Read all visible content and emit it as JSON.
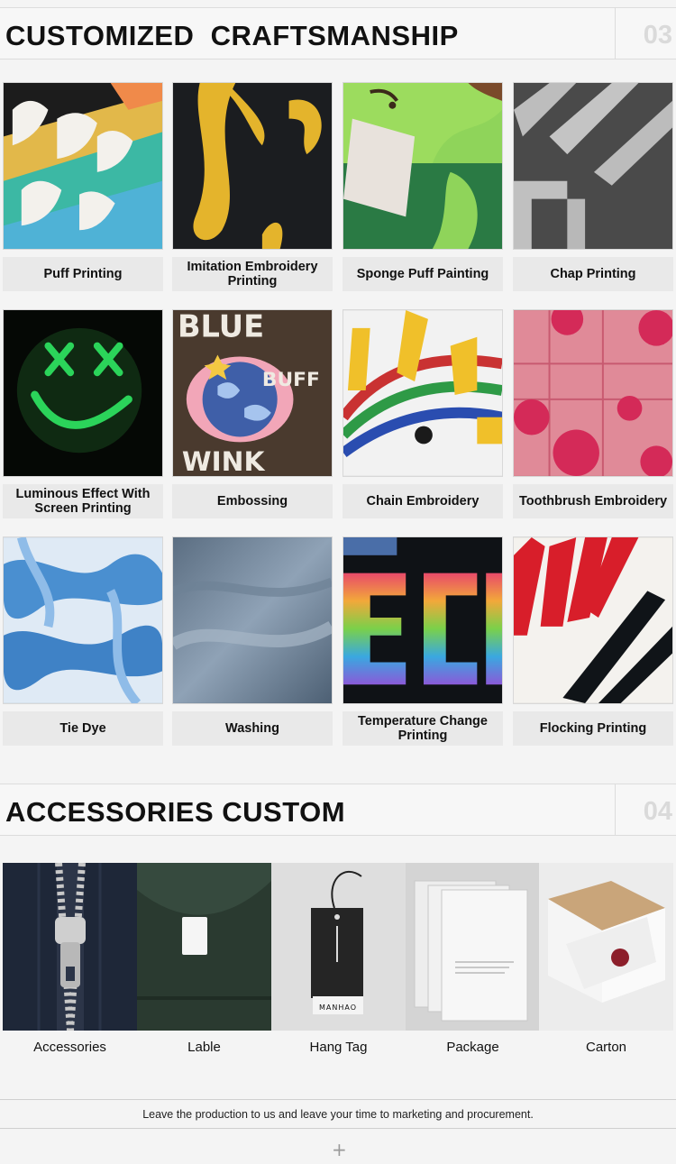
{
  "craftsmanship": {
    "title": "CUSTOMIZED  CRAFTSMANSHIP",
    "number": "03",
    "items": [
      {
        "label": "Puff Printing",
        "icon": "puff-printing-photo"
      },
      {
        "label": "Imitation Embroidery Printing",
        "icon": "imitation-embroidery-photo"
      },
      {
        "label": "Sponge Puff Painting",
        "icon": "sponge-puff-photo"
      },
      {
        "label": "Chap Printing",
        "icon": "chap-printing-photo"
      },
      {
        "label": "Luminous Effect With Screen Printing",
        "icon": "luminous-smiley-photo"
      },
      {
        "label": "Embossing",
        "icon": "embossing-photo"
      },
      {
        "label": "Chain Embroidery",
        "icon": "chain-embroidery-photo"
      },
      {
        "label": "Toothbrush Embroidery",
        "icon": "toothbrush-embroidery-photo"
      },
      {
        "label": "Tie Dye",
        "icon": "tie-dye-photo"
      },
      {
        "label": "Washing",
        "icon": "washing-photo"
      },
      {
        "label": "Temperature Change Printing",
        "icon": "temperature-change-photo"
      },
      {
        "label": "Flocking Printing",
        "icon": "flocking-printing-photo"
      }
    ]
  },
  "accessories": {
    "title": "ACCESSORIES CUSTOM",
    "number": "04",
    "items": [
      {
        "label": "Accessories",
        "icon": "zipper-photo"
      },
      {
        "label": "Lable",
        "icon": "neck-label-photo"
      },
      {
        "label": "Hang Tag",
        "icon": "hang-tag-photo",
        "tag_text": "MANHAO"
      },
      {
        "label": "Package",
        "icon": "package-bags-photo"
      },
      {
        "label": "Carton",
        "icon": "carton-box-photo"
      }
    ]
  },
  "footer": {
    "tagline": "Leave the production to us and leave your time to marketing and procurement.",
    "plus_symbol": "+"
  }
}
